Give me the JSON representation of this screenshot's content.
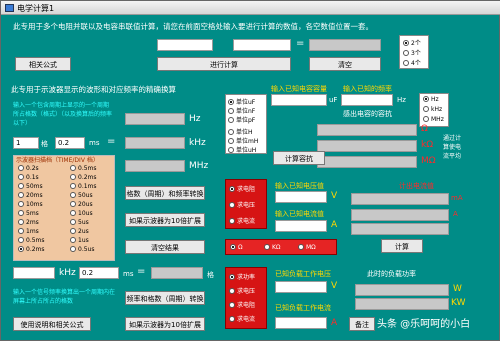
{
  "window": {
    "title": "电学计算1"
  },
  "top": {
    "description": "此专用于多个电阻并联以及电容串联值计算，请您在前面空格处输入要进行计算的数值，各空数值位置一套。",
    "btn_formula": "相关公式",
    "btn_calc": "进行计算",
    "btn_clear": "清空",
    "count_options": [
      "2个",
      "3个",
      "4个"
    ],
    "count_selected": "2个"
  },
  "scope": {
    "heading": "此专用于示波器显示的波形和对应频率的精确换算",
    "instruction": "输入一个包含周期上显示的一个周期所占格数（格式）（以及换算后的频率以下）",
    "unit_hz": "Hz",
    "unit_khz": "kHz",
    "unit_mhz": "MHz",
    "label_ge": "格",
    "label_ms": "ms",
    "input_ge": "1",
    "input_ms": "0.2",
    "group_title": "示波器扫描档（TIME/DIV 档）",
    "ranges_left": [
      "0.2s",
      "0.1s",
      "50ms",
      "20ms",
      "10ms",
      "5ms",
      "2ms",
      "1ms",
      "0.5ms",
      "0.2ms"
    ],
    "ranges_right": [
      "0.5ms",
      "0.2ms",
      "0.1ms",
      "50us",
      "20us",
      "10us",
      "5us",
      "2us",
      "1us",
      "0.5us"
    ],
    "ranges_extra": [
      "0.2us",
      "0.1us"
    ],
    "range_selected": "0.2ms",
    "btn_convert_freq": "格数（周期）和频率转换",
    "btn_scope_10x_a": "如果示波器为10倍扩展",
    "btn_clear_results": "清空结果",
    "input_freq_unit": "kHz",
    "input_freq_value": "0.2",
    "label_freq_ms": "ms",
    "instruction2": "输入一个信号频率换算出一个周期内在屏幕上所占所占的格数",
    "btn_freq_to_ge": "频率和格数（周期）转换",
    "btn_scope_10x_b": "如果示波器为10倍扩展",
    "btn_usage": "使用说明和相关公式"
  },
  "impedance": {
    "heading_cap": "输入已知电容容量",
    "unit_uf": "uF",
    "heading_freq": "输入已知的频率",
    "unit_hz": "Hz",
    "cap_units": [
      "单位uF",
      "单位nF",
      "单位pF"
    ],
    "ind_units": [
      "单位H",
      "单位mH",
      "单位uH"
    ],
    "cap_selected": "单位uF",
    "freq_units": [
      "Hz",
      "kHz",
      "MHz"
    ],
    "freq_selected": "Hz",
    "note_reactance": "感出电容的容抗",
    "unit_ohm": "Ω",
    "unit_kohm": "kΩ",
    "unit_mohm": "MΩ",
    "note_right": "通过计算使电流平均",
    "btn_calc_reactance": "计算容抗"
  },
  "power": {
    "options": [
      "求电阻",
      "求电压",
      "求电流"
    ],
    "selected": "求电阻",
    "label_voltage": "输入已知电压值",
    "unit_v": "V",
    "label_current": "输入已知电流值",
    "unit_a": "A",
    "header_result": "计出电流值",
    "unit_ma": "mA",
    "ohm_options": [
      "Ω",
      "KΩ",
      "MΩ"
    ],
    "ohm_selected": "Ω",
    "btn_calc": "计算"
  },
  "power2": {
    "options": [
      "求功率",
      "求电压",
      "求电阻",
      "求电流"
    ],
    "selected": "求功率",
    "label_voltage": "已知负载工作电压",
    "unit_v": "V",
    "label_current": "已知负载工作电流",
    "unit_a": "A",
    "header_power": "此时的负载功率",
    "unit_w": "W",
    "unit_kw": "KW",
    "btn_note": "备注"
  },
  "watermark": "头条 @乐呵呵的小白"
}
